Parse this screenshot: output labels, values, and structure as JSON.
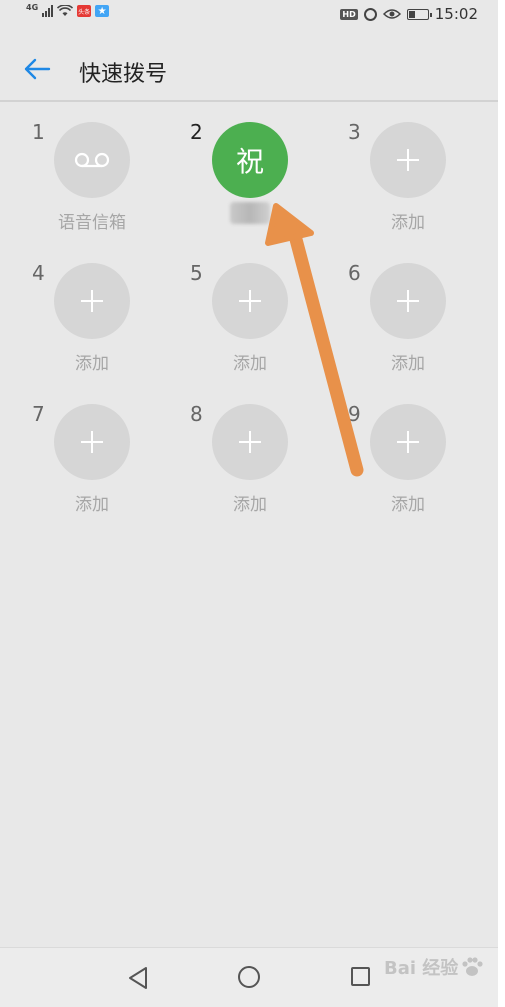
{
  "status_bar": {
    "network": "4G",
    "app_badge_1": "头条",
    "hd_badge": "HD",
    "time": "15:02",
    "battery_level": 0.35
  },
  "header": {
    "title": "快速拨号"
  },
  "slots": [
    {
      "number": "1",
      "label": "语音信箱",
      "kind": "voicemail"
    },
    {
      "number": "2",
      "avatar_text": "祝",
      "kind": "contact",
      "label": ""
    },
    {
      "number": "3",
      "label": "添加",
      "kind": "add"
    },
    {
      "number": "4",
      "label": "添加",
      "kind": "add"
    },
    {
      "number": "5",
      "label": "添加",
      "kind": "add"
    },
    {
      "number": "6",
      "label": "添加",
      "kind": "add"
    },
    {
      "number": "7",
      "label": "添加",
      "kind": "add"
    },
    {
      "number": "8",
      "label": "添加",
      "kind": "add"
    },
    {
      "number": "9",
      "label": "添加",
      "kind": "add"
    }
  ],
  "colors": {
    "contact_avatar": "#4caf50",
    "empty_avatar": "#d6d6d6",
    "back_arrow": "#1e88e5",
    "annotation_arrow": "#e8914a"
  },
  "watermark": {
    "text": "Bai  经验"
  }
}
